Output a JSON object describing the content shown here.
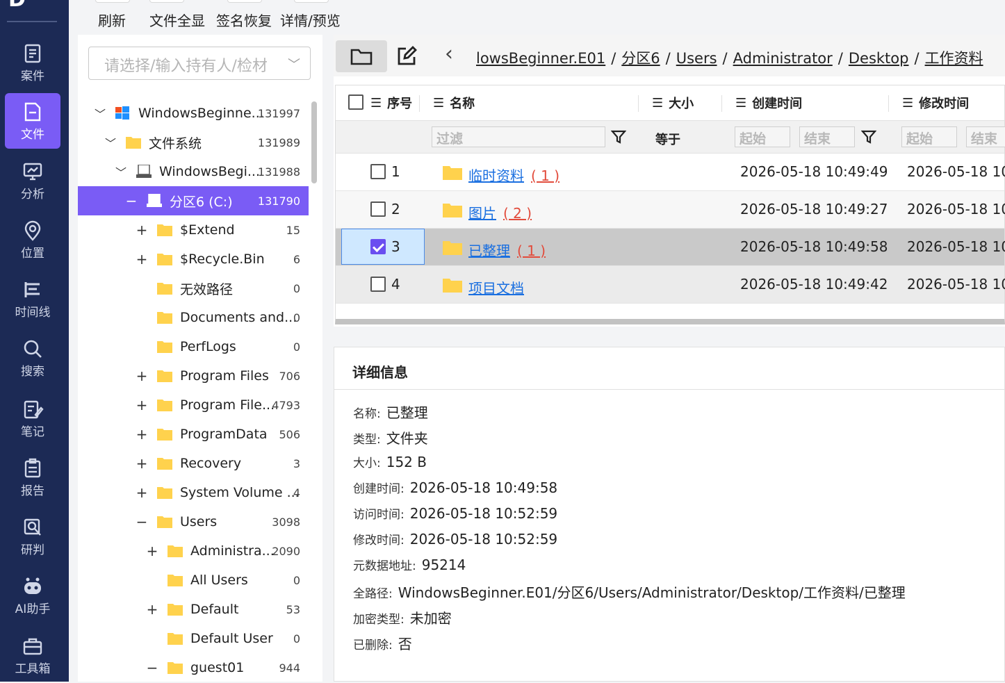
{
  "nav": {
    "logo": "D",
    "items": [
      {
        "label": "案件",
        "icon": "case-icon"
      },
      {
        "label": "文件",
        "icon": "file-icon"
      },
      {
        "label": "分析",
        "icon": "analysis-icon"
      },
      {
        "label": "位置",
        "icon": "location-icon"
      },
      {
        "label": "时间线",
        "icon": "timeline-icon"
      },
      {
        "label": "搜索",
        "icon": "search-icon"
      },
      {
        "label": "笔记",
        "icon": "note-icon"
      },
      {
        "label": "报告",
        "icon": "report-icon"
      },
      {
        "label": "研判",
        "icon": "judge-icon"
      },
      {
        "label": "AI助手",
        "icon": "robot-icon"
      },
      {
        "label": "工具箱",
        "icon": "toolbox-icon"
      }
    ],
    "active": "文件"
  },
  "toolbar": {
    "refresh": "刷新",
    "show_all": "文件全显",
    "sig_recover": "签名恢复",
    "detail_preview": "详情/预览"
  },
  "owner_select": {
    "placeholder": "请选择/输入持有人/检材"
  },
  "tree": [
    {
      "toggle": "chevron-down",
      "icon": "windows-icon",
      "label": "WindowsBeginne...",
      "count": "131997"
    },
    {
      "toggle": "chevron-down",
      "icon": "folder-icon",
      "label": "文件系统",
      "count": "131989"
    },
    {
      "toggle": "chevron-down",
      "icon": "disk-icon",
      "label": "WindowsBegi...",
      "count": "131988"
    },
    {
      "toggle": "−",
      "icon": "disk-icon",
      "label": "分区6  (C:)",
      "count": "131790",
      "selected": true
    },
    {
      "toggle": "+",
      "icon": "folder-icon",
      "label": "$Extend",
      "count": "15"
    },
    {
      "toggle": "+",
      "icon": "folder-icon",
      "label": "$Recycle.Bin",
      "count": "6"
    },
    {
      "toggle": "",
      "icon": "folder-icon",
      "label": "无效路径",
      "count": "0"
    },
    {
      "toggle": "",
      "icon": "folder-icon",
      "label": "Documents and...",
      "count": "0"
    },
    {
      "toggle": "",
      "icon": "folder-icon",
      "label": "PerfLogs",
      "count": "0"
    },
    {
      "toggle": "+",
      "icon": "folder-icon",
      "label": "Program Files",
      "count": "706"
    },
    {
      "toggle": "+",
      "icon": "folder-icon",
      "label": "Program File...",
      "count": "4793"
    },
    {
      "toggle": "+",
      "icon": "folder-icon",
      "label": "ProgramData",
      "count": "506"
    },
    {
      "toggle": "+",
      "icon": "folder-icon",
      "label": "Recovery",
      "count": "3"
    },
    {
      "toggle": "+",
      "icon": "folder-icon",
      "label": "System Volume ...",
      "count": "4"
    },
    {
      "toggle": "−",
      "icon": "folder-icon",
      "label": "Users",
      "count": "3098"
    },
    {
      "toggle": "+",
      "icon": "folder-icon",
      "label": "Administra...",
      "count": "2090"
    },
    {
      "toggle": "",
      "icon": "folder-icon",
      "label": "All Users",
      "count": "0"
    },
    {
      "toggle": "+",
      "icon": "folder-icon",
      "label": "Default",
      "count": "53"
    },
    {
      "toggle": "",
      "icon": "folder-icon",
      "label": "Default User",
      "count": "0"
    },
    {
      "toggle": "−",
      "icon": "folder-icon",
      "label": "guest01",
      "count": "944"
    }
  ],
  "breadcrumb": {
    "back": "‹",
    "parts": [
      "lowsBeginner.E01",
      "分区6",
      "Users",
      "Administrator",
      "Desktop",
      "工作资料"
    ],
    "sep": "/"
  },
  "table": {
    "headers": {
      "seq": "序号",
      "name": "名称",
      "size": "大小",
      "created": "创建时间",
      "modified": "修改时间"
    },
    "filter": {
      "name_placeholder": "过滤",
      "size_op": "等于",
      "start": "起始",
      "end": "结束"
    },
    "rows": [
      {
        "seq": "1",
        "name": "临时资料",
        "count": "( 1 )",
        "created": "2026-05-18 10:49:49",
        "modified": "2026-05-18 10:",
        "checked": false
      },
      {
        "seq": "2",
        "name": "图片",
        "count": "( 2 )",
        "created": "2026-05-18 10:49:27",
        "modified": "2026-05-18 10:",
        "checked": false
      },
      {
        "seq": "3",
        "name": "已整理",
        "count": "( 1 )",
        "created": "2026-05-18 10:49:58",
        "modified": "2026-05-18 10:",
        "checked": true
      },
      {
        "seq": "4",
        "name": "项目文档",
        "count": "",
        "created": "2026-05-18 10:49:42",
        "modified": "2026-05-18 10:",
        "checked": false
      }
    ]
  },
  "detail": {
    "title": "详细信息",
    "fields": [
      {
        "k": "名称:",
        "v": "已整理"
      },
      {
        "k": "类型:",
        "v": "文件夹"
      },
      {
        "k": "大小:",
        "v": "152 B"
      },
      {
        "k": "创建时间:",
        "v": "2026-05-18 10:49:58"
      },
      {
        "k": "访问时间:",
        "v": "2026-05-18 10:52:59"
      },
      {
        "k": "修改时间:",
        "v": "2026-05-18 10:52:59"
      },
      {
        "k": "元数据地址:",
        "v": "95214"
      },
      {
        "k": "全路径:",
        "v": "WindowsBeginner.E01/分区6/Users/Administrator/Desktop/工作资料/已整理"
      },
      {
        "k": "加密类型:",
        "v": "未加密"
      },
      {
        "k": "已删除:",
        "v": "否"
      }
    ]
  },
  "colors": {
    "nav_bg": "#1c2a55",
    "accent": "#7a5cf5",
    "link": "#1a6fe0",
    "count": "#e24b3b",
    "folder": "#ffd24d"
  }
}
